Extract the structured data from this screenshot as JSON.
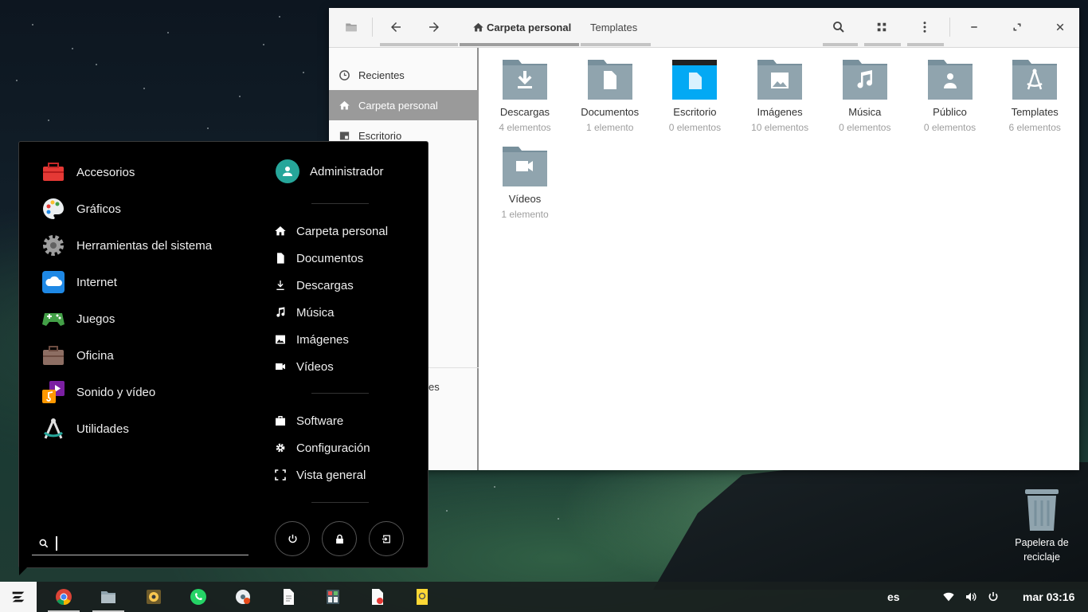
{
  "file_manager": {
    "breadcrumbs": [
      "Carpeta personal",
      "Templates"
    ],
    "sidebar": [
      {
        "label": "Recientes",
        "icon": "clock-icon"
      },
      {
        "label": "Carpeta personal",
        "icon": "home-icon",
        "active": true
      },
      {
        "label": "Escritorio",
        "icon": "desktop-icon"
      }
    ],
    "sidebar_partial": "es",
    "files": [
      {
        "name": "Descargas",
        "count": "4 elementos",
        "icon": "download-folder-icon"
      },
      {
        "name": "Documentos",
        "count": "1 elemento",
        "icon": "documents-folder-icon"
      },
      {
        "name": "Escritorio",
        "count": "0 elementos",
        "icon": "desktop-folder-icon"
      },
      {
        "name": "Imágenes",
        "count": "10 elementos",
        "icon": "images-folder-icon"
      },
      {
        "name": "Música",
        "count": "0 elementos",
        "icon": "music-folder-icon"
      },
      {
        "name": "Público",
        "count": "0 elementos",
        "icon": "public-folder-icon"
      },
      {
        "name": "Templates",
        "count": "6 elementos",
        "icon": "templates-folder-icon"
      },
      {
        "name": "Vídeos",
        "count": "1 elemento",
        "icon": "videos-folder-icon"
      }
    ],
    "colors": {
      "folder": "#90a4ae",
      "folder_dark": "#78909c",
      "desktop_folder": "#03a9f4"
    }
  },
  "start_menu": {
    "categories": [
      {
        "label": "Accesorios",
        "icon": "toolbox-icon"
      },
      {
        "label": "Gráficos",
        "icon": "palette-icon"
      },
      {
        "label": "Herramientas del sistema",
        "icon": "gear-icon"
      },
      {
        "label": "Internet",
        "icon": "cloud-icon"
      },
      {
        "label": "Juegos",
        "icon": "gamepad-icon"
      },
      {
        "label": "Oficina",
        "icon": "briefcase-icon"
      },
      {
        "label": "Sonido y vídeo",
        "icon": "media-icon"
      },
      {
        "label": "Utilidades",
        "icon": "compass-icon"
      }
    ],
    "user": "Administrador",
    "places": [
      {
        "label": "Carpeta personal",
        "icon": "home-icon"
      },
      {
        "label": "Documentos",
        "icon": "document-icon"
      },
      {
        "label": "Descargas",
        "icon": "download-icon"
      },
      {
        "label": "Música",
        "icon": "music-icon"
      },
      {
        "label": "Imágenes",
        "icon": "image-icon"
      },
      {
        "label": "Vídeos",
        "icon": "video-icon"
      }
    ],
    "system": [
      {
        "label": "Software",
        "icon": "bag-icon"
      },
      {
        "label": "Configuración",
        "icon": "settings-icon"
      },
      {
        "label": "Vista general",
        "icon": "overview-icon"
      }
    ],
    "search": {
      "value": "",
      "placeholder": ""
    }
  },
  "desktop": {
    "trash_label": "Papelera de reciclaje"
  },
  "taskbar": {
    "apps": [
      "chrome-icon",
      "files-icon",
      "rhythmbox-icon",
      "whatsapp-icon",
      "media-player-icon",
      "text-editor-icon",
      "calculator-icon",
      "document-viewer-icon",
      "mail-icon"
    ],
    "language": "es",
    "clock": "mar 03:16"
  }
}
